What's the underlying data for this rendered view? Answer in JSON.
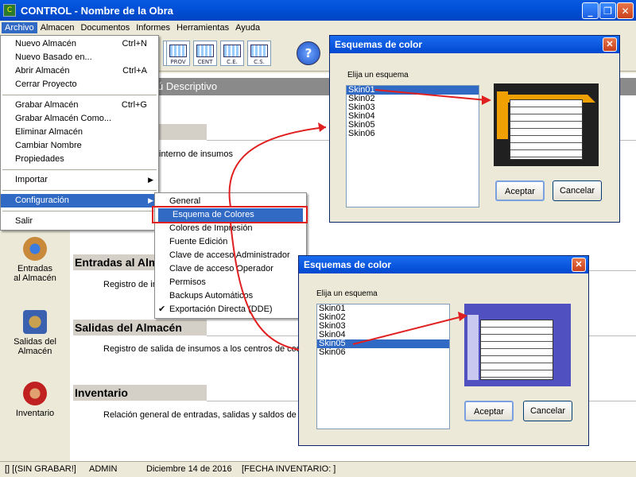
{
  "window": {
    "title": "CONTROL - Nombre de la Obra",
    "app_icon": "C",
    "buttons": {
      "minimize": "_",
      "maximize": "❐",
      "close": "✕"
    }
  },
  "menubar": [
    "Archivo",
    "Almacen",
    "Documentos",
    "Informes",
    "Herramientas",
    "Ayuda"
  ],
  "toolbar": {
    "tools": [
      "",
      "PROV",
      "CENT",
      "C.E.",
      "C.S."
    ],
    "help": "?"
  },
  "content": {
    "header": "ú Descriptivo",
    "sections": [
      {
        "title": "",
        "desc": "interno de insumos"
      },
      {
        "title": "Entradas al Alma",
        "desc": "Registro de in"
      },
      {
        "title": "Salidas del Almacén",
        "desc": "Registro de salida de insumos a los centros de cos"
      },
      {
        "title": "Inventario",
        "desc": "Relación general de entradas, salidas y saldos de in"
      }
    ]
  },
  "left_panel": [
    {
      "label1": "Entradas",
      "label2": "al Almacén",
      "icon": "person-box-icon"
    },
    {
      "label1": "Salidas del",
      "label2": "Almacén",
      "icon": "boxes-icon"
    },
    {
      "label1": "Inventario",
      "label2": "",
      "icon": "person-icon"
    }
  ],
  "archivo_menu": {
    "items": [
      {
        "label": "Nuevo Almacén",
        "shortcut": "Ctrl+N"
      },
      {
        "label": "Nuevo Basado en...",
        "shortcut": ""
      },
      {
        "label": "Abrir Almacén",
        "shortcut": "Ctrl+A"
      },
      {
        "label": "Cerrar Proyecto",
        "shortcut": ""
      },
      {
        "label": "Grabar Almacén",
        "shortcut": "Ctrl+G"
      },
      {
        "label": "Grabar Almacén Como...",
        "shortcut": ""
      },
      {
        "label": "Eliminar Almacén",
        "shortcut": ""
      },
      {
        "label": "Cambiar Nombre",
        "shortcut": ""
      },
      {
        "label": "Propiedades",
        "shortcut": ""
      },
      {
        "label": "Importar",
        "shortcut": ""
      },
      {
        "label": "Configuración",
        "shortcut": ""
      },
      {
        "label": "Salir",
        "shortcut": ""
      }
    ]
  },
  "config_menu": {
    "items": [
      "General",
      "Esquema de Colores",
      "Colores de Impresión",
      "Fuente Edición",
      "Clave de acceso Administrador",
      "Clave de acceso Operador",
      "Permisos",
      "Backups Automáticos",
      "Exportación Directa (DDE)"
    ],
    "selected": "Esquema de Colores",
    "checked": "Exportación Directa (DDE)"
  },
  "dialog1": {
    "title": "Esquemas de color",
    "label": "Elija un esquema",
    "options": [
      "Skin01",
      "Skin02",
      "Skin03",
      "Skin04",
      "Skin05",
      "Skin06"
    ],
    "selected": "Skin01",
    "accept": "Aceptar",
    "cancel": "Cancelar"
  },
  "dialog2": {
    "title": "Esquemas de color",
    "label": "Elija un esquema",
    "options": [
      "Skin01",
      "Skin02",
      "Skin03",
      "Skin04",
      "Skin05",
      "Skin06"
    ],
    "selected": "Skin05",
    "accept": "Aceptar",
    "cancel": "Cancelar"
  },
  "statusbar": {
    "status": "[] [(SIN GRABAR!]",
    "user": "ADMIN",
    "date": "Diciembre 14 de 2016",
    "inventory": "[FECHA INVENTARIO: ]"
  },
  "colors": {
    "accent": "#316ac5",
    "annotation": "#e02020",
    "skin01_frame": "#f0a000",
    "skin05_frame": "#5050c0"
  }
}
